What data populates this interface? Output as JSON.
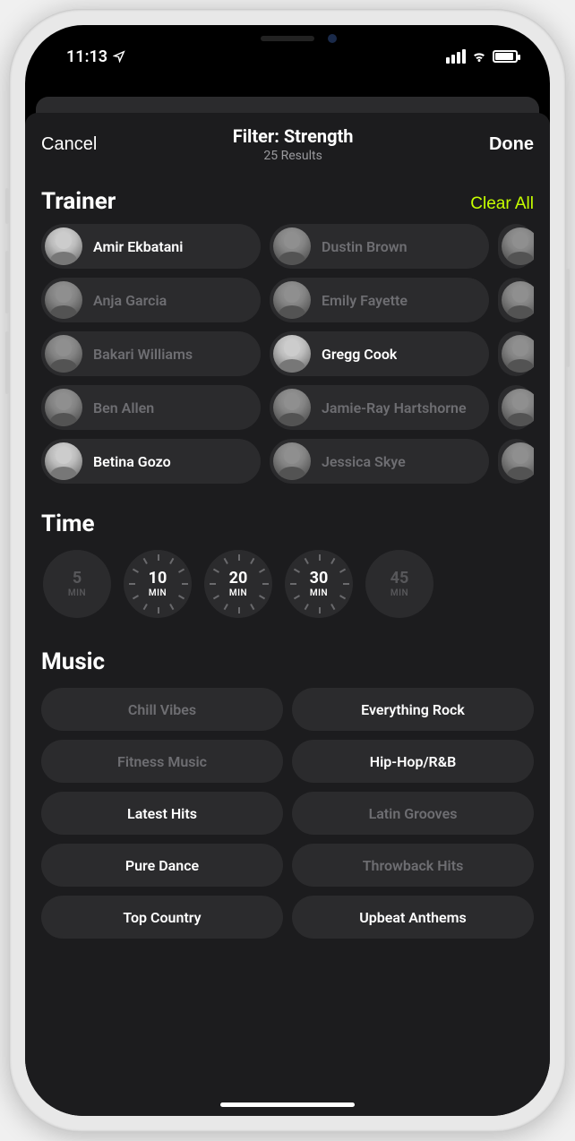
{
  "status": {
    "time": "11:13"
  },
  "header": {
    "cancel": "Cancel",
    "done": "Done",
    "title": "Filter: Strength",
    "subtitle": "25 Results"
  },
  "sections": {
    "trainer": {
      "title": "Trainer",
      "clear": "Clear All",
      "columns": [
        [
          {
            "name": "Amir Ekbatani",
            "selected": true
          },
          {
            "name": "Anja Garcia",
            "selected": false
          },
          {
            "name": "Bakari Williams",
            "selected": false
          },
          {
            "name": "Ben Allen",
            "selected": false
          },
          {
            "name": "Betina Gozo",
            "selected": true
          }
        ],
        [
          {
            "name": "Dustin Brown",
            "selected": false
          },
          {
            "name": "Emily Fayette",
            "selected": false
          },
          {
            "name": "Gregg Cook",
            "selected": true
          },
          {
            "name": "Jamie-Ray Hartshorne",
            "selected": false
          },
          {
            "name": "Jessica Skye",
            "selected": false
          }
        ]
      ]
    },
    "time": {
      "title": "Time",
      "unit": "MIN",
      "options": [
        {
          "value": "5",
          "selected": false,
          "available": false
        },
        {
          "value": "10",
          "selected": true,
          "available": true
        },
        {
          "value": "20",
          "selected": true,
          "available": true
        },
        {
          "value": "30",
          "selected": true,
          "available": true
        },
        {
          "value": "45",
          "selected": false,
          "available": false
        }
      ]
    },
    "music": {
      "title": "Music",
      "options": [
        {
          "label": "Chill Vibes",
          "selected": false
        },
        {
          "label": "Everything Rock",
          "selected": true
        },
        {
          "label": "Fitness Music",
          "selected": false
        },
        {
          "label": "Hip-Hop/R&B",
          "selected": true
        },
        {
          "label": "Latest Hits",
          "selected": true
        },
        {
          "label": "Latin Grooves",
          "selected": false
        },
        {
          "label": "Pure Dance",
          "selected": true
        },
        {
          "label": "Throwback Hits",
          "selected": false
        },
        {
          "label": "Top Country",
          "selected": true
        },
        {
          "label": "Upbeat Anthems",
          "selected": true
        }
      ]
    }
  }
}
